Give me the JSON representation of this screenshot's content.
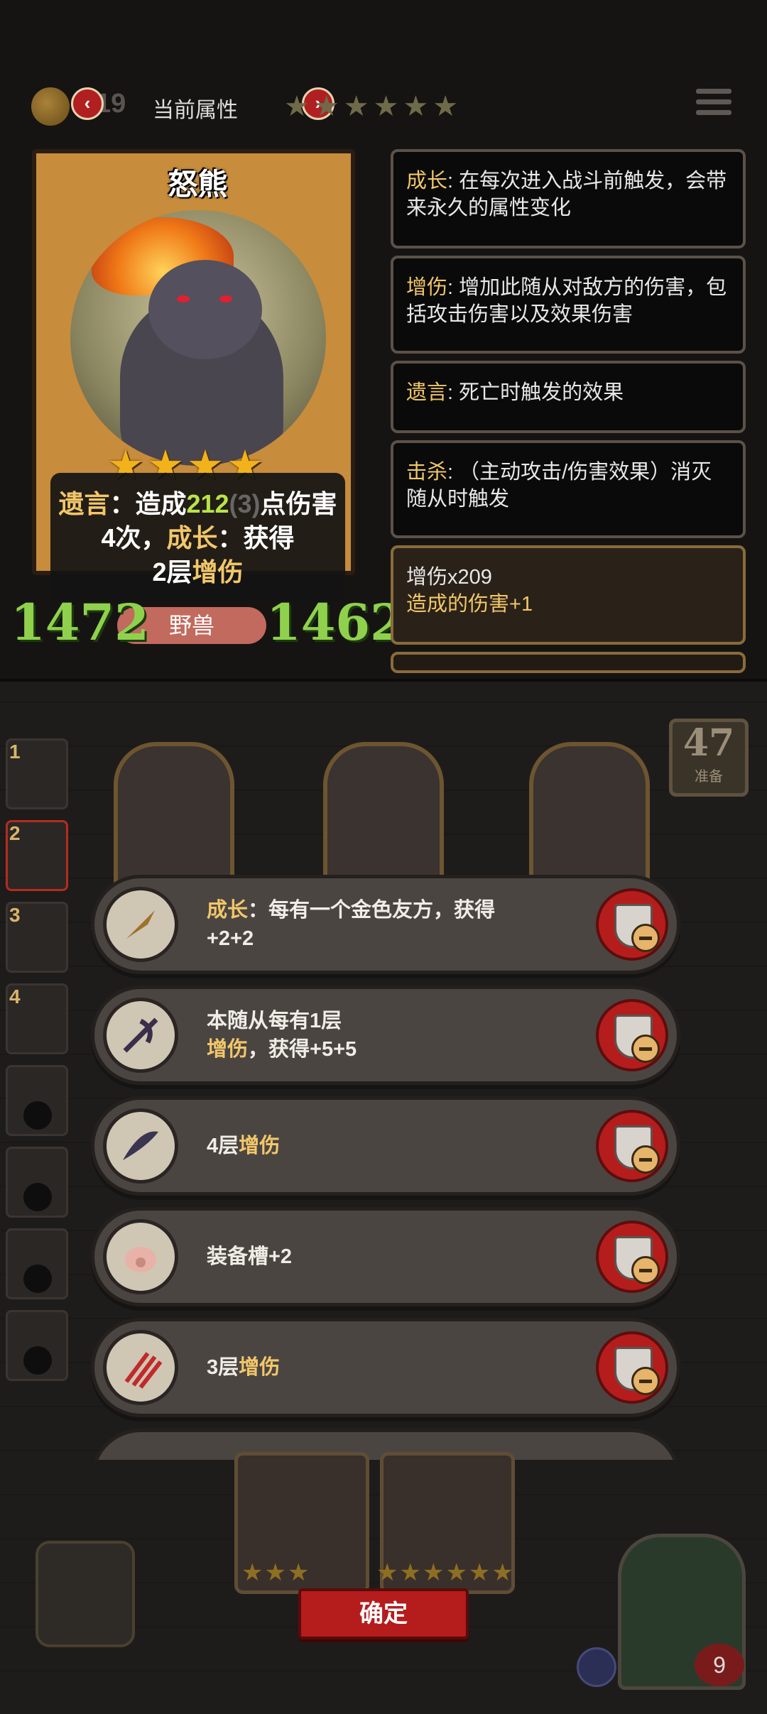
{
  "header": {
    "level": "19",
    "title": "当前属性",
    "stars": "★★★★★★"
  },
  "card": {
    "name": "怒熊",
    "stars": "★★★★",
    "desc": {
      "kw1": "遗言",
      "part1": "：造成",
      "value": "212",
      "base": "(3)",
      "part2": "点伤害4次，",
      "kw2": "成长",
      "part3": "：获得",
      "part4": "2层",
      "kw3": "增伤"
    },
    "attack": "1472",
    "health": "1462",
    "tribe": "野兽"
  },
  "keywords": [
    {
      "name": "成长",
      "text": ": 在每次进入战斗前触发，会带来永久的属性变化"
    },
    {
      "name": "增伤",
      "text": ": 增加此随从对敌方的伤害，包括攻击伤害以及效果伤害"
    },
    {
      "name": "遗言",
      "text": ": 死亡时触发的效果"
    },
    {
      "name": "击杀",
      "text": ": （主动攻击/伤害效果）消灭随从时触发"
    }
  ],
  "buff_panel": {
    "title": "增伤x209",
    "effect_prefix": "造成的伤害",
    "effect_value": "+1"
  },
  "board": {
    "ready_count": "47",
    "ready_label": "准备",
    "side_slots": [
      "1",
      "2",
      "3",
      "4"
    ]
  },
  "choices": [
    {
      "line1_kw": "成长",
      "line1": "：每有一个金色友方，获得",
      "line2": "+2+2",
      "line2_kw": ""
    },
    {
      "line1_kw": "",
      "line1": "本随从每有1层",
      "line2": "，获得+5+5",
      "line2_kw": "增伤"
    },
    {
      "line1_kw": "",
      "line1": "4层",
      "line2": "",
      "line2_kw": "",
      "inline_kw": "增伤"
    },
    {
      "line1_kw": "",
      "line1": "装备槽+2",
      "line2": "",
      "line2_kw": ""
    },
    {
      "line1_kw": "",
      "line1": "3层",
      "line2": "",
      "line2_kw": "",
      "inline_kw": "增伤"
    }
  ],
  "confirm_label": "确定",
  "lives": "9"
}
